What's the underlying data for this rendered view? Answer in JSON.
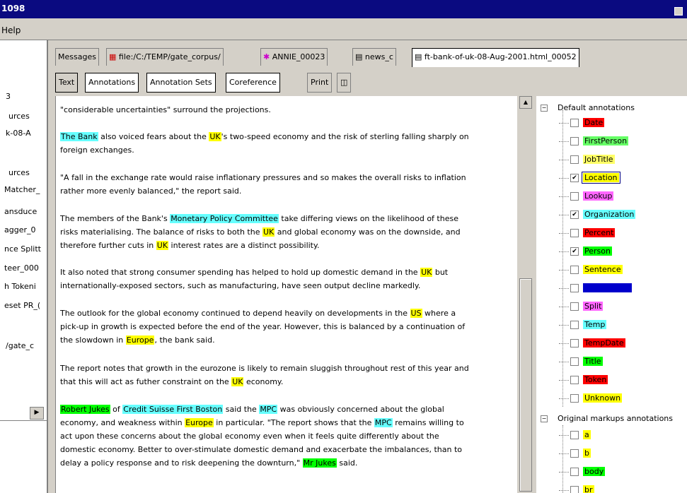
{
  "window": {
    "title": "1098"
  },
  "menu": {
    "help": "Help"
  },
  "left_panel": {
    "items": [
      "3",
      "urces",
      "k-08-A",
      "urces",
      "Matcher_",
      "ansduce",
      "agger_0",
      "nce Splitt",
      "teer_000",
      "h Tokeni",
      "eset PR_(",
      "/gate_c"
    ]
  },
  "doc_tabs": [
    "Messages",
    "file:/C:/TEMP/gate_corpus/",
    "ANNIE_00023",
    "news_c",
    "ft-bank-of-uk-08-Aug-2001.html_00052"
  ],
  "view_tabs": [
    "Text",
    "Annotations",
    "Annotation Sets",
    "Coreference"
  ],
  "toolbar": {
    "print": "Print"
  },
  "text": {
    "p0": "\"considerable uncertainties\" surround the projections.",
    "p1": [
      "The Bank",
      " also voiced fears about the ",
      "UK",
      "'s two-speed economy and the risk of sterling falling sharply on",
      "foreign exchanges."
    ],
    "p2": [
      "\"A fall in the exchange rate would raise inflationary pressures and so makes the overall risks to inflation",
      "rather more evenly balanced,\" the report said."
    ],
    "p3": [
      "The members of the Bank's ",
      "Monetary Policy Committee",
      " take differing views on the likelihood of these",
      "risks materialising. The balance of risks to both the ",
      "UK",
      " and global economy was on the downside, and",
      "therefore further cuts in ",
      "UK",
      " interest rates are a distinct possibility."
    ],
    "p4": [
      "It also noted that strong consumer spending has helped to hold up domestic demand in the ",
      "UK",
      " but",
      "internationally-exposed sectors, such as manufacturing, have seen output decline markedly."
    ],
    "p5": [
      "The outlook for the global economy continued to depend heavily on developments in the ",
      "US",
      " where a",
      "pick-up in growth is expected before the end of the year. However, this is balanced by a continuation of",
      "the slowdown in ",
      "Europe",
      ", the bank said."
    ],
    "p6": [
      "The report notes that growth in the eurozone is likely to remain sluggish throughout rest of this year and",
      "that this will act as futher constraint on the ",
      "UK",
      " economy."
    ],
    "p7": [
      "Robert Jukes",
      " of ",
      "Credit Suisse First Boston",
      " said the ",
      "MPC",
      " was obviously concerned about the global",
      "economy, and weakness within ",
      "Europe",
      " in particular. \"The report shows that the ",
      "MPC",
      " remains willing to",
      "act upon these concerns about the global economy even when it feels quite differently about the",
      "domestic economy. Better to over-stimulate domestic demand and exacerbate the imbalances, than to",
      "delay a policy response and to risk deepening the downturn,\" ",
      "Mr Jukes",
      " said."
    ]
  },
  "annotations": {
    "default_group": "Default annotations",
    "original_group": "Original markups annotations",
    "default_items": [
      {
        "label": "Date",
        "checked": false,
        "color": "#ff0000"
      },
      {
        "label": "FirstPerson",
        "checked": false,
        "color": "#66ff66"
      },
      {
        "label": "JobTitle",
        "checked": false,
        "color": "#ffff66"
      },
      {
        "label": "Location",
        "checked": true,
        "color": "#ffff00"
      },
      {
        "label": "Lookup",
        "checked": false,
        "color": "#ff66ff"
      },
      {
        "label": "Organization",
        "checked": true,
        "color": "#66ffff"
      },
      {
        "label": "Percent",
        "checked": false,
        "color": "#ff0000"
      },
      {
        "label": "Person",
        "checked": true,
        "color": "#00ff00"
      },
      {
        "label": "Sentence",
        "checked": false,
        "color": "#ffff00"
      },
      {
        "label": "SpaceToken",
        "checked": false,
        "color": "#0000cc"
      },
      {
        "label": "Split",
        "checked": false,
        "color": "#ff66ff"
      },
      {
        "label": "Temp",
        "checked": false,
        "color": "#66ffff"
      },
      {
        "label": "TempDate",
        "checked": false,
        "color": "#ff0000"
      },
      {
        "label": "Title",
        "checked": false,
        "color": "#00ff00"
      },
      {
        "label": "Token",
        "checked": false,
        "color": "#ff0000"
      },
      {
        "label": "Unknown",
        "checked": false,
        "color": "#ffff00"
      }
    ],
    "original_items": [
      {
        "label": "a",
        "checked": false,
        "color": "#ffff00"
      },
      {
        "label": "b",
        "checked": false,
        "color": "#ffff00"
      },
      {
        "label": "body",
        "checked": false,
        "color": "#00ff00"
      },
      {
        "label": "br",
        "checked": false,
        "color": "#ffff00"
      }
    ]
  },
  "colors": {
    "location": "#ffff00",
    "organization": "#66ffff",
    "person": "#00ff00",
    "titlebar": "#0a0a80"
  }
}
